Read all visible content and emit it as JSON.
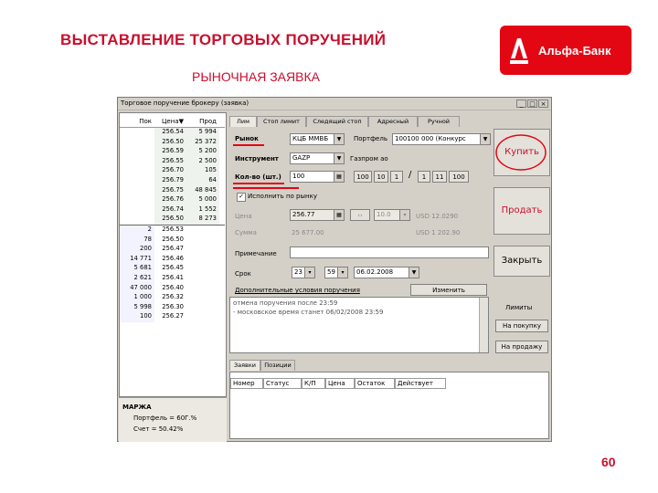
{
  "slide": {
    "title": "ВЫСТАВЛЕНИЕ ТОРГОВЫХ ПОРУЧЕНИЙ",
    "subtitle": "РЫНОЧНАЯ ЗАЯВКА",
    "page_number": "60",
    "logo_text": "Альфа-Банк",
    "accent_color": "#c8102e"
  },
  "window": {
    "title": "Торговое поручение брокеру (заявка)",
    "minimize_icon": "_",
    "maximize_icon": "□",
    "close_icon": "×"
  },
  "quotes": {
    "headers": [
      "Пок",
      "Цена▼",
      "Прод"
    ],
    "rows": [
      [
        "",
        "256.54",
        "5 994"
      ],
      [
        "",
        "256.50",
        "25 372"
      ],
      [
        "",
        "256.59",
        "5 200"
      ],
      [
        "",
        "256.55",
        "2 500"
      ],
      [
        "",
        "256.70",
        "105"
      ],
      [
        "",
        "256.79",
        "64"
      ],
      [
        "",
        "256.75",
        "48 845"
      ],
      [
        "",
        "256.76",
        "5 000"
      ],
      [
        "",
        "256.74",
        "1 552"
      ],
      [
        "",
        "256.50",
        "8 273"
      ],
      [
        "2",
        "256.53",
        ""
      ],
      [
        "78",
        "256.50",
        ""
      ],
      [
        "200",
        "256.47",
        ""
      ],
      [
        "14 771",
        "256.46",
        ""
      ],
      [
        "5 681",
        "256.45",
        ""
      ],
      [
        "2 621",
        "256.41",
        ""
      ],
      [
        "47 000",
        "256.40",
        ""
      ],
      [
        "1 000",
        "256.32",
        ""
      ],
      [
        "5 998",
        "256.30",
        ""
      ],
      [
        "100",
        "256.27",
        ""
      ]
    ],
    "margin_title": "МАРЖА",
    "margin_portfolio": "Портфель = 60Г.%",
    "margin_account": "Счет = 50.42%"
  },
  "tabs": [
    "Лим",
    "Стоп лимит",
    "Следящий стоп",
    "Адресный",
    "Ручной"
  ],
  "form": {
    "market_label": "Рынок",
    "market_value": "КЦБ ММВБ",
    "portfolio_label": "Портфель",
    "portfolio_value": "100100 000 (Конкурс",
    "instrument_label": "Инструмент",
    "instrument_value": "GAZP",
    "gazprom_label": "Газпром ао",
    "qty_label": "Кол-во (шт.)",
    "qty_value": "100",
    "qty_buttons": [
      "100",
      "10",
      "1"
    ],
    "qty_buttons2": [
      "1",
      "11",
      "100"
    ],
    "market_checkbox_label": "Исполнить по рынку",
    "price_label": "Цена",
    "price_value": "256.77",
    "price_step": "10.0",
    "usd_price": "USD 12.0290",
    "amount_label": "Сумма",
    "amount_value": "25 677.00",
    "usd_amount": "USD 1 202.90",
    "note_label": "Примечание",
    "term_label": "Срок",
    "term_hour": "23",
    "term_minute": "59",
    "term_date": "06.02.2008",
    "extra_conditions": "Дополнительные условия поручения",
    "change_button": "Изменить",
    "info_text_1": "отмена поручения после 23:59",
    "info_text_2": "- московское время станет 06/02/2008 23:59"
  },
  "actions": {
    "buy": "Купить",
    "sell": "Продать",
    "close": "Закрыть",
    "limits_title": "Лимиты",
    "limit_buy": "На покупку",
    "limit_sell": "На продажу"
  },
  "bottom_tabs": [
    "Заявки",
    "Позиции"
  ],
  "orders_headers": [
    "Номер",
    "Статус",
    "К/П",
    "Цена",
    "Остаток",
    "Действует"
  ]
}
